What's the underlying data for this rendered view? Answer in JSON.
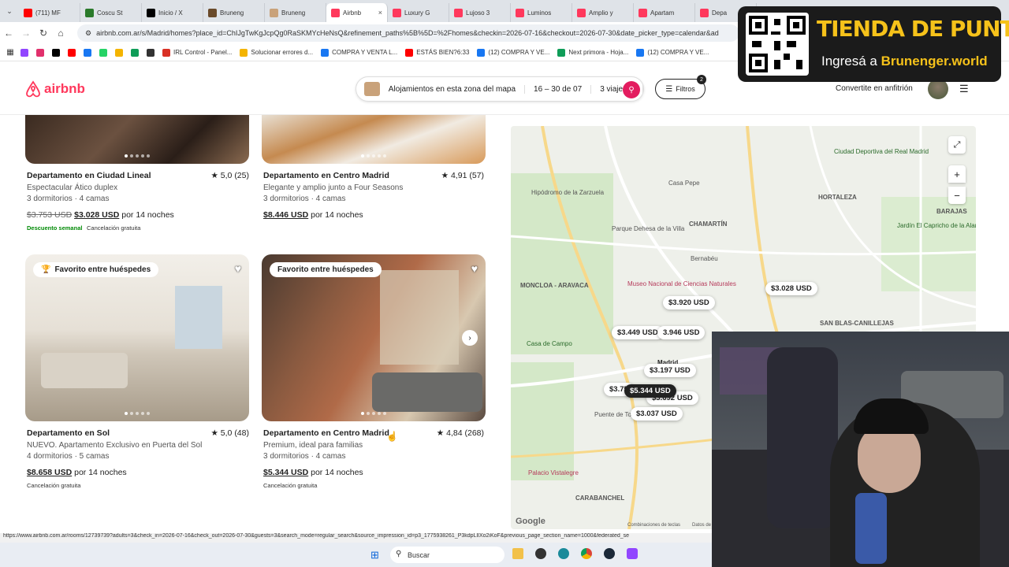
{
  "browser": {
    "tabs": [
      {
        "label": "(711) MF",
        "color": "#ff0000"
      },
      {
        "label": "Coscu St",
        "color": "#2a7a2a"
      },
      {
        "label": "Inicio / X",
        "color": "#000000"
      },
      {
        "label": "Bruneng",
        "color": "#6a4a2a"
      },
      {
        "label": "Bruneng",
        "color": "#c9a27a"
      },
      {
        "label": "Airbnb",
        "color": "#ff385c",
        "active": true
      },
      {
        "label": "Luxury G",
        "color": "#ff385c"
      },
      {
        "label": "Lujoso 3",
        "color": "#ff385c"
      },
      {
        "label": "Luminos",
        "color": "#ff385c"
      },
      {
        "label": "Amplio y",
        "color": "#ff385c"
      },
      {
        "label": "Apartam",
        "color": "#ff385c"
      },
      {
        "label": "Depa",
        "color": "#ff385c"
      }
    ],
    "url": "airbnb.com.ar/s/Madrid/homes?place_id=ChIJgTwKgJcpQg0RaSKMYcHeNsQ&refinement_paths%5B%5D=%2Fhomes&checkin=2026-07-16&checkout=2026-07-30&date_picker_type=calendar&ad",
    "bookmarks": [
      {
        "label": "",
        "color": "#9146ff"
      },
      {
        "label": "",
        "color": "#e1306c"
      },
      {
        "label": "",
        "color": "#000000"
      },
      {
        "label": "",
        "color": "#ff0000"
      },
      {
        "label": "",
        "color": "#1877f2"
      },
      {
        "label": "",
        "color": "#25d366"
      },
      {
        "label": "",
        "color": "#f4b400"
      },
      {
        "label": "",
        "color": "#0f9d58"
      },
      {
        "label": "",
        "color": "#333333"
      },
      {
        "label": "IRL Control - Panel...",
        "color": "#d93025"
      },
      {
        "label": "Solucionar errores d...",
        "color": "#f4b400"
      },
      {
        "label": "COMPRA Y VENTA L...",
        "color": "#1877f2"
      },
      {
        "label": "ESTÁS BIEN?6:33",
        "color": "#ff0000"
      },
      {
        "label": "(12) COMPRA Y VE...",
        "color": "#1877f2"
      },
      {
        "label": "Next primora - Hoja...",
        "color": "#0f9d58"
      },
      {
        "label": "(12) COMPRA Y VE...",
        "color": "#1877f2"
      }
    ],
    "status_url": "https://www.airbnb.com.ar/rooms/12739739?adults=3&check_in=2026-07-16&check_out=2026-07-30&guests=3&search_mode=regular_search&source_impression_id=p3_1775938261_P3kdpLlIXo2iKoF&previous_page_section_name=1000&federated_se"
  },
  "header": {
    "logo": "airbnb",
    "search_location": "Alojamientos en esta zona del mapa",
    "search_dates": "16 – 30 de 07",
    "search_guests": "3 viajeros",
    "filters_label": "Filtros",
    "filters_count": "2",
    "host_label": "Convertite en anfitrión"
  },
  "listings": [
    {
      "title": "Departamento en Ciudad Lineal",
      "rating": "★ 5,0 (25)",
      "subtitle": "Espectacular Ático duplex",
      "details": "3 dormitorios · 4 camas",
      "old_price": "$3.753 USD",
      "price": "$3.028 USD",
      "price_suffix": " por 14 noches",
      "tags": [
        "Descuento semanal",
        "Cancelación gratuita"
      ],
      "guest_favorite": ""
    },
    {
      "title": "Departamento en Centro Madrid",
      "rating": "★ 4,91 (57)",
      "subtitle": "Elegante y amplio junto a Four Seasons",
      "details": "3 dormitorios · 4 camas",
      "old_price": "",
      "price": "$8.446 USD",
      "price_suffix": " por 14 noches",
      "tags": [],
      "guest_favorite": ""
    },
    {
      "title": "Departamento en Sol",
      "rating": "★ 5,0 (48)",
      "subtitle": "NUEVO. Apartamento Exclusivo en Puerta del Sol",
      "details": "4 dormitorios · 5 camas",
      "old_price": "",
      "price": "$8.658 USD",
      "price_suffix": " por 14 noches",
      "tags": [
        "Cancelación gratuita"
      ],
      "guest_favorite": "Favorito entre huéspedes"
    },
    {
      "title": "Departamento en Centro Madrid",
      "rating": "★ 4,84 (268)",
      "subtitle": "Premium, ideal para familias",
      "details": "3 dormitorios · 4 camas",
      "old_price": "",
      "price": "$5.344 USD",
      "price_suffix": " por 14 noches",
      "tags": [
        "Cancelación gratuita"
      ],
      "guest_favorite": "Favorito entre huéspedes"
    }
  ],
  "map": {
    "labels": [
      "Hipódromo de la Zarzuela",
      "Casa Pepe",
      "Parque Dehesa de la Villa",
      "CHAMARTÍN",
      "Bernabéu",
      "MONCLOA - ARAVACA",
      "Museo Nacional de Ciencias Naturales",
      "Casa de Campo",
      "HORTALEZA",
      "BARAJAS",
      "Ciudad Deportiva del Real Madrid",
      "Jardín El Capricho de la Alameda de Osuna",
      "SAN BLAS-CANILLEJAS",
      "Puente de Toledo",
      "Palacio Vistalegre",
      "CARABANCHEL",
      "Madrid",
      "Google",
      "Combinaciones de teclas",
      "Datos de"
    ],
    "pins": [
      {
        "label": "$3.920 USD",
        "dark": false
      },
      {
        "label": "$3.028 USD",
        "dark": false
      },
      {
        "label": "$3.449 USD",
        "dark": false
      },
      {
        "label": "3.946 USD",
        "dark": false
      },
      {
        "label": "$3.197 USD",
        "dark": false
      },
      {
        "label": "$3.75",
        "dark": false
      },
      {
        "label": "$3.692 USD",
        "dark": false
      },
      {
        "label": "$5.344 USD",
        "dark": true
      },
      {
        "label": "$3.037 USD",
        "dark": false
      }
    ],
    "zoom_in": "+",
    "zoom_out": "−"
  },
  "promo": {
    "title": "TIENDA DE PUNTOS",
    "sub_prefix": "Ingresá a ",
    "sub_link": "Brunenger.world"
  },
  "taskbar": {
    "search_placeholder": "Buscar"
  }
}
